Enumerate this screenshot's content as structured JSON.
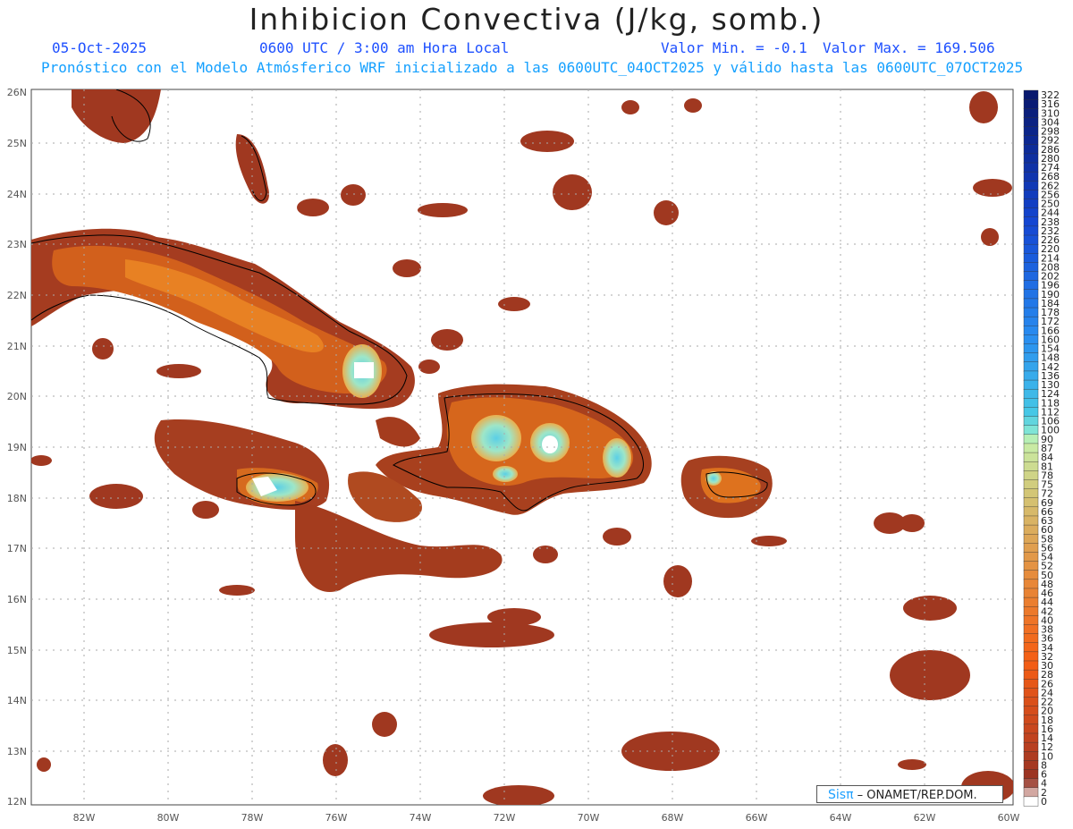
{
  "header": {
    "title": "Inhibicion Convectiva (J/kg, somb.)",
    "date": "05-Oct-2025",
    "time": "0600 UTC / 3:00 am Hora Local",
    "valmin": "Valor Min. = -0.1",
    "valmax": "Valor Max. = 169.506",
    "forecast": "Pronóstico con el Modelo Atmósferico WRF inicializado a las 0600UTC_04OCT2025 y válido hasta las  0600UTC_07OCT2025"
  },
  "map": {
    "lat_labels": [
      "26N",
      "25N",
      "24N",
      "23N",
      "22N",
      "21N",
      "20N",
      "19N",
      "18N",
      "17N",
      "16N",
      "15N",
      "14N",
      "13N",
      "12N"
    ],
    "lon_labels": [
      "82W",
      "80W",
      "78W",
      "76W",
      "74W",
      "72W",
      "70W",
      "68W",
      "66W",
      "64W",
      "62W",
      "60W"
    ]
  },
  "colorbar": {
    "labels": [
      "322",
      "316",
      "310",
      "304",
      "298",
      "292",
      "286",
      "280",
      "274",
      "268",
      "262",
      "256",
      "250",
      "244",
      "238",
      "232",
      "226",
      "220",
      "214",
      "208",
      "202",
      "196",
      "190",
      "184",
      "178",
      "172",
      "166",
      "160",
      "154",
      "148",
      "142",
      "136",
      "130",
      "124",
      "118",
      "112",
      "106",
      "100",
      "90",
      "87",
      "84",
      "81",
      "78",
      "75",
      "72",
      "69",
      "66",
      "63",
      "60",
      "58",
      "56",
      "54",
      "52",
      "50",
      "48",
      "46",
      "44",
      "42",
      "40",
      "38",
      "36",
      "34",
      "32",
      "30",
      "28",
      "26",
      "24",
      "22",
      "20",
      "18",
      "16",
      "14",
      "12",
      "10",
      "8",
      "6",
      "4",
      "2",
      "0"
    ]
  },
  "credit": {
    "logo": "Sisπ",
    "text": "– ONAMET/REP.DOM."
  },
  "colors": {
    "land_low": "#9a3520",
    "land_mid": "#d05a18",
    "land_high": "#f0901e",
    "cyan": "#6ee0e6",
    "coast": "#000000"
  }
}
